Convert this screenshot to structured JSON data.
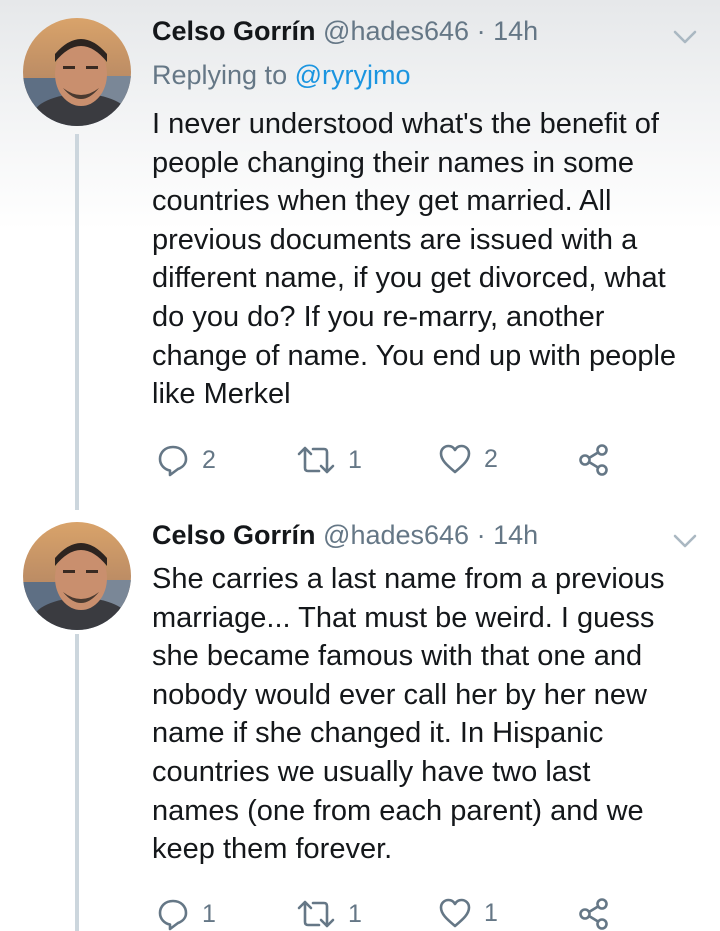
{
  "tweets": [
    {
      "author_name": "Celso Gorrín",
      "handle": "@hades646",
      "separator": "·",
      "time": "14h",
      "reply_prefix": "Replying to",
      "reply_to": "@ryryjmo",
      "text": "I never understood what's the benefit of\npeople changing their names in some\ncountries when they get married. All\nprevious documents are issued with a\ndifferent name, if you get divorced, what\ndo you do? If you re-marry, another\nchange of name. You end up with people\nlike Merkel",
      "replies": "2",
      "retweets": "1",
      "likes": "2"
    },
    {
      "author_name": "Celso Gorrín",
      "handle": "@hades646",
      "separator": "·",
      "time": "14h",
      "text": "She carries a last name from a previous\nmarriage... That must be weird. I guess\nshe became famous with that one and\nnobody would ever call her by her new\nname if she changed it. In Hispanic\ncountries we usually have two last\nnames (one from each parent) and we\nkeep them forever.",
      "replies": "1",
      "retweets": "1",
      "likes": "1"
    }
  ],
  "icons": {
    "reply": "reply-icon",
    "retweet": "retweet-icon",
    "like": "heart-icon",
    "share": "share-icon",
    "menu": "chevron-down-icon"
  },
  "colors": {
    "text": "#14171a",
    "secondary": "#657786",
    "link": "#1b95e0",
    "thread_line": "#ccd6dd"
  }
}
